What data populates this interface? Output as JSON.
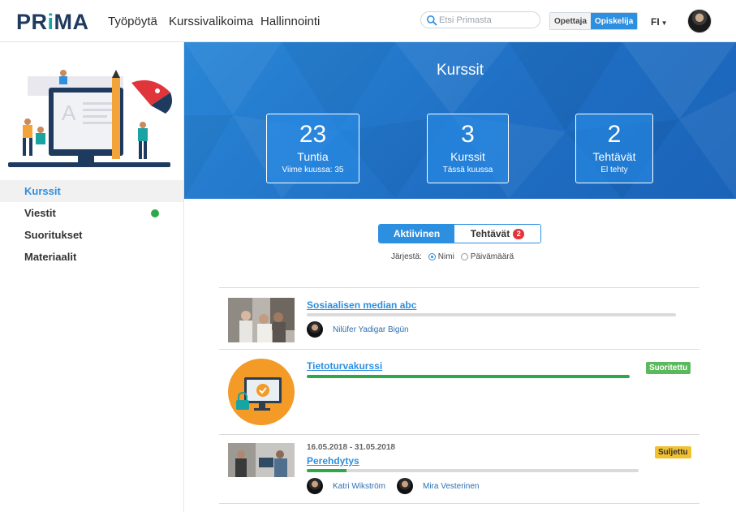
{
  "brand": {
    "logo_parts": [
      "PR",
      "i",
      "MA"
    ]
  },
  "nav": [
    {
      "label": "Työpöytä"
    },
    {
      "label": "Kurssivalikoima"
    },
    {
      "label": "Hallinnointi"
    }
  ],
  "search": {
    "placeholder": "Etsi Primasta",
    "value": ""
  },
  "roles": {
    "teacher": "Opettaja",
    "student": "Opiskelija",
    "selected": "Opiskelija"
  },
  "language": {
    "code": "FI"
  },
  "sidebar": {
    "items": [
      {
        "label": "Kurssit",
        "active": true
      },
      {
        "label": "Viestit",
        "has_indicator": true
      },
      {
        "label": "Suoritukset"
      },
      {
        "label": "Materiaalit"
      }
    ]
  },
  "hero": {
    "title": "Kurssit",
    "stats": [
      {
        "value": "23",
        "label": "Tuntia",
        "sub": "Viime kuussa: 35"
      },
      {
        "value": "3",
        "label": "Kurssit",
        "sub": "Tässä kuussa"
      },
      {
        "value": "2",
        "label": "Tehtävät",
        "sub": "El tehty"
      }
    ]
  },
  "tabs": [
    {
      "label": "Aktiivinen",
      "selected": true
    },
    {
      "label": "Tehtävät",
      "badge": "2"
    }
  ],
  "sort": {
    "label": "Järjestä:",
    "options": [
      {
        "label": "Nimi",
        "checked": true
      },
      {
        "label": "Päivämäärä",
        "checked": false
      }
    ]
  },
  "courses": [
    {
      "title": "Sosiaalisen median abc",
      "progress": 0,
      "teachers": [
        "Nilüfer Yadigar Bigün"
      ]
    },
    {
      "title": "Tietoturvakurssi",
      "progress": 1.0,
      "status": "Suoritettu"
    },
    {
      "date_range": "16.05.2018 - 31.05.2018",
      "title": "Perehdytys",
      "progress": 0.12,
      "status": "Suljettu",
      "teachers": [
        "Katri Wikström",
        "Mira Vesterinen"
      ]
    }
  ],
  "colors": {
    "accent": "#2d8fe0",
    "brand_navy": "#1f3a5f",
    "brand_teal": "#19a3a3",
    "progress_green": "#2ea84a",
    "badge_red": "#e0363b",
    "status_done": "#5cb85c",
    "status_closed": "#f2c12e"
  }
}
